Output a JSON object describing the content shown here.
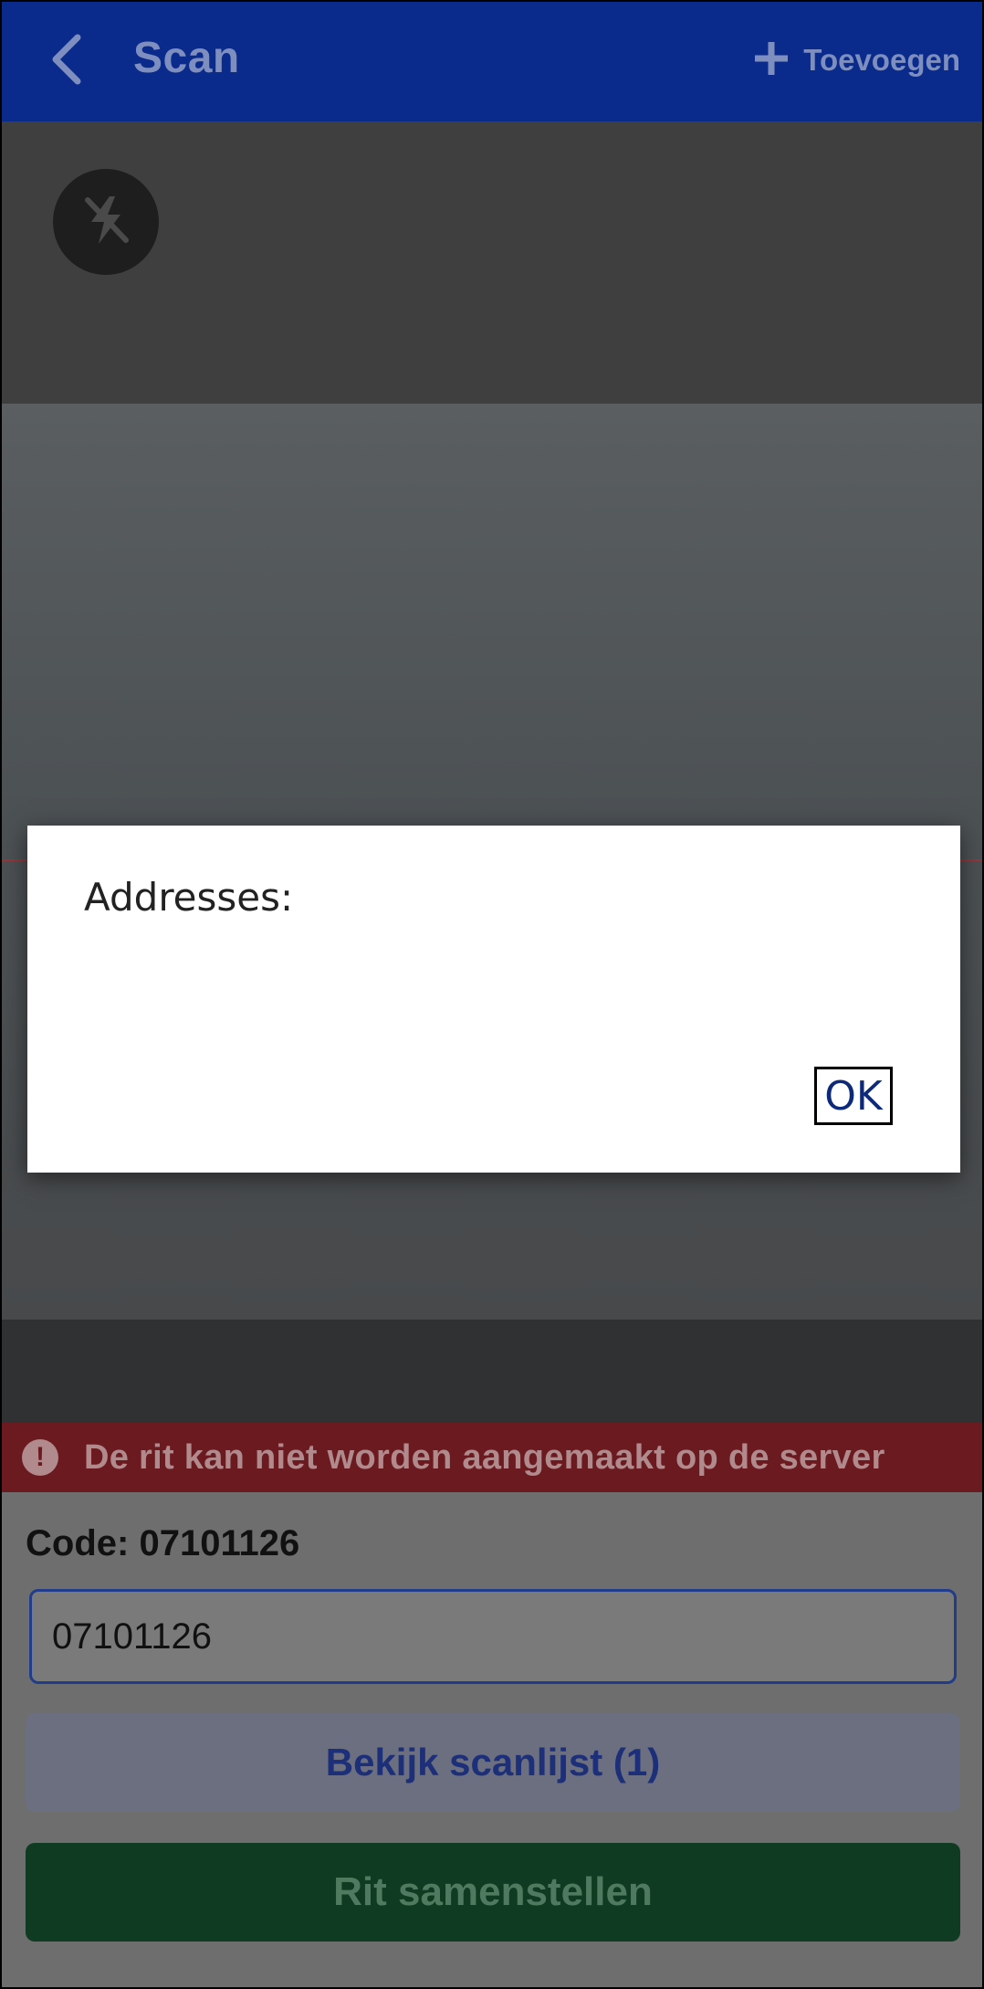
{
  "appbar": {
    "title": "Scan",
    "add_label": "Toevoegen"
  },
  "error": {
    "message": "De rit kan niet worden aangemaakt op de server"
  },
  "code": {
    "label": "Code:",
    "value": "07101126",
    "input_value": "07101126"
  },
  "buttons": {
    "scanlist": "Bekijk scanlijst (1)",
    "compose": "Rit samenstellen"
  },
  "dialog": {
    "title": "Addresses:",
    "ok_label": "OK"
  },
  "colors": {
    "appbar": "#0a2a8c",
    "error": "#c62828",
    "primary_green": "#1b6b3a",
    "dialog_ok": "#0d2a7a"
  }
}
